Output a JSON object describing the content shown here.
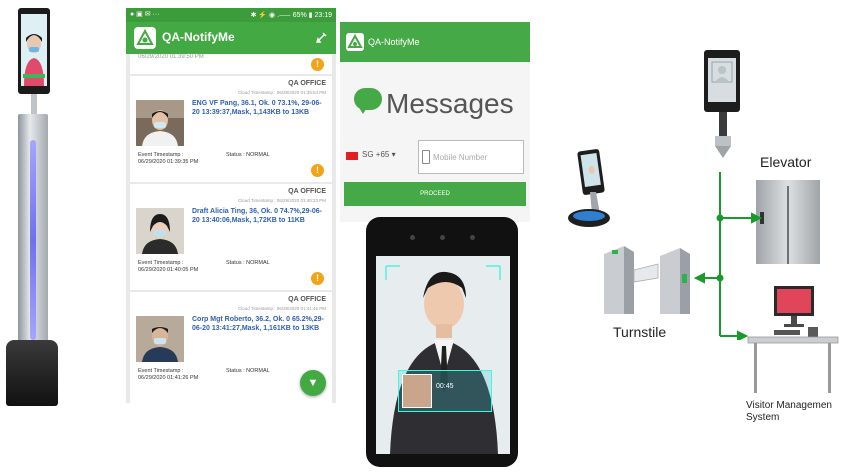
{
  "phone": {
    "status_left": "● ▣ ✉ ···",
    "status_right": "✱ ⚡ ◉ .⸺ 65% ▮ 23:19",
    "app_title": "QA-NotifyMe",
    "cut_text": "06/29/2020 01:39:50 PM",
    "cards": [
      {
        "office": "QA OFFICE",
        "cloud": "Cloud Timestamp : 06/29/2020 01:39:54 PM",
        "message": "ENG VF Pang, 36.1, Ok. 0 73.1%, 29-06-20 13:39:37,Mask, 1,143KB to 13KB",
        "event_label": "Event Timestamp :",
        "event_value": "06/29/2020 01:39:35 PM",
        "status": "Status : NORMAL"
      },
      {
        "office": "QA OFFICE",
        "cloud": "Cloud Timestamp : 06/29/2020 01:40:23 PM",
        "message": "Draft Alicia Ting, 36, Ok. 0 74.7%,29-06-20 13:40:06,Mask, 1,72KB to 11KB",
        "event_label": "Event Timestamp :",
        "event_value": "06/29/2020 01:40:05 PM",
        "status": "Status : NORMAL"
      },
      {
        "office": "QA OFFICE",
        "cloud": "Cloud Timestamp : 06/29/2020 01:41:45 PM",
        "message": "Corp Mgt Roberto, 36.2, Ok. 0 65.2%,29-06-20 13:41:27,Mask, 1,161KB to 13KB",
        "event_label": "Event Timestamp :",
        "event_value": "06/29/2020 01:41:26 PM",
        "status": "Status : NORMAL"
      }
    ]
  },
  "web": {
    "title": "QA-NotifyMe",
    "heading": "Messages",
    "country_code": "SG +65 ▾",
    "mobile_placeholder": "Mobile Number",
    "proceed_label": "PROCEED"
  },
  "terminal": {
    "overlay_label": "00:45"
  },
  "labels": {
    "elevator": "Elevator",
    "turnstile": "Turnstile",
    "vms_line1": "Visitor Managemen",
    "vms_line2": "System"
  },
  "colors": {
    "green": "#43a943",
    "blue_text": "#2f5fb3",
    "warning": "#f2a316",
    "connector": "#1a9a2a"
  }
}
